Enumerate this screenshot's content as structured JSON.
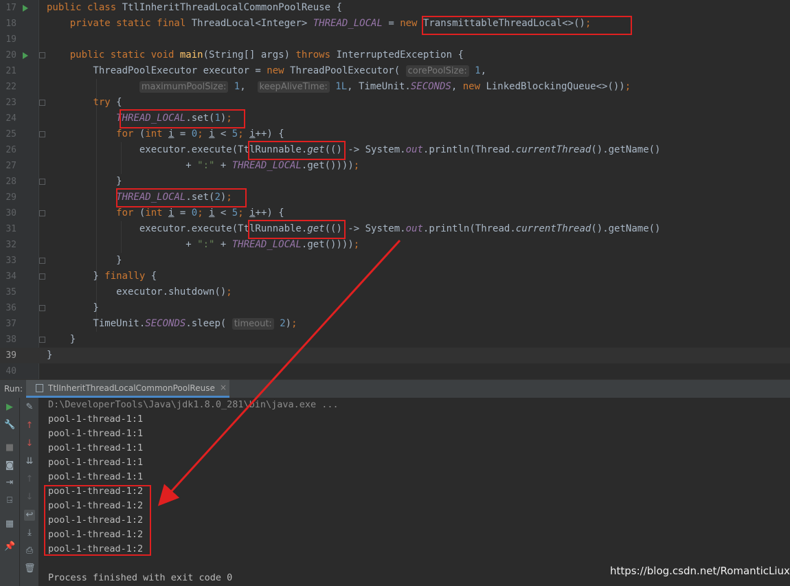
{
  "editor": {
    "line_numbers": [
      "17",
      "18",
      "19",
      "20",
      "21",
      "22",
      "23",
      "24",
      "25",
      "26",
      "27",
      "28",
      "29",
      "30",
      "31",
      "32",
      "33",
      "34",
      "35",
      "36",
      "37",
      "38",
      "39",
      "40"
    ],
    "current_line": "39",
    "hints": {
      "core_pool_size": "corePoolSize:",
      "maximum_pool_size": "maximumPoolSize:",
      "keep_alive_time": "keepAliveTime:",
      "timeout": "timeout:"
    }
  },
  "run_panel": {
    "label": "Run:",
    "tab_title": "TtlInheritThreadLocalCommonPoolReuse",
    "close_glyph": "×",
    "command": "D:\\DeveloperTools\\Java\\jdk1.8.0_281\\bin\\java.exe ...",
    "output": [
      "pool-1-thread-1:1",
      "pool-1-thread-1:1",
      "pool-1-thread-1:1",
      "pool-1-thread-1:1",
      "pool-1-thread-1:1",
      "pool-1-thread-1:2",
      "pool-1-thread-1:2",
      "pool-1-thread-1:2",
      "pool-1-thread-1:2",
      "pool-1-thread-1:2"
    ],
    "exit_message": "Process finished with exit code 0",
    "toolbar_icons": [
      "rerun-icon",
      "wrench-icon",
      "stop-icon",
      "camera-icon",
      "exit-icon",
      "layout-icon",
      "pin-icon",
      "edit-icon",
      "up-arrow-icon",
      "down-arrow-icon",
      "sort-icon",
      "scroll-up-icon",
      "scroll-down-icon",
      "soft-wrap-icon",
      "scroll-to-end-icon",
      "print-icon",
      "trash-icon"
    ]
  },
  "watermark": "https://blog.csdn.net/RomanticLiuxu",
  "colors": {
    "annotation": "#e02020",
    "keyword": "#cc7832",
    "field": "#9876aa",
    "number": "#6897bb",
    "string": "#6a8759",
    "method_decl": "#ffc66d"
  }
}
